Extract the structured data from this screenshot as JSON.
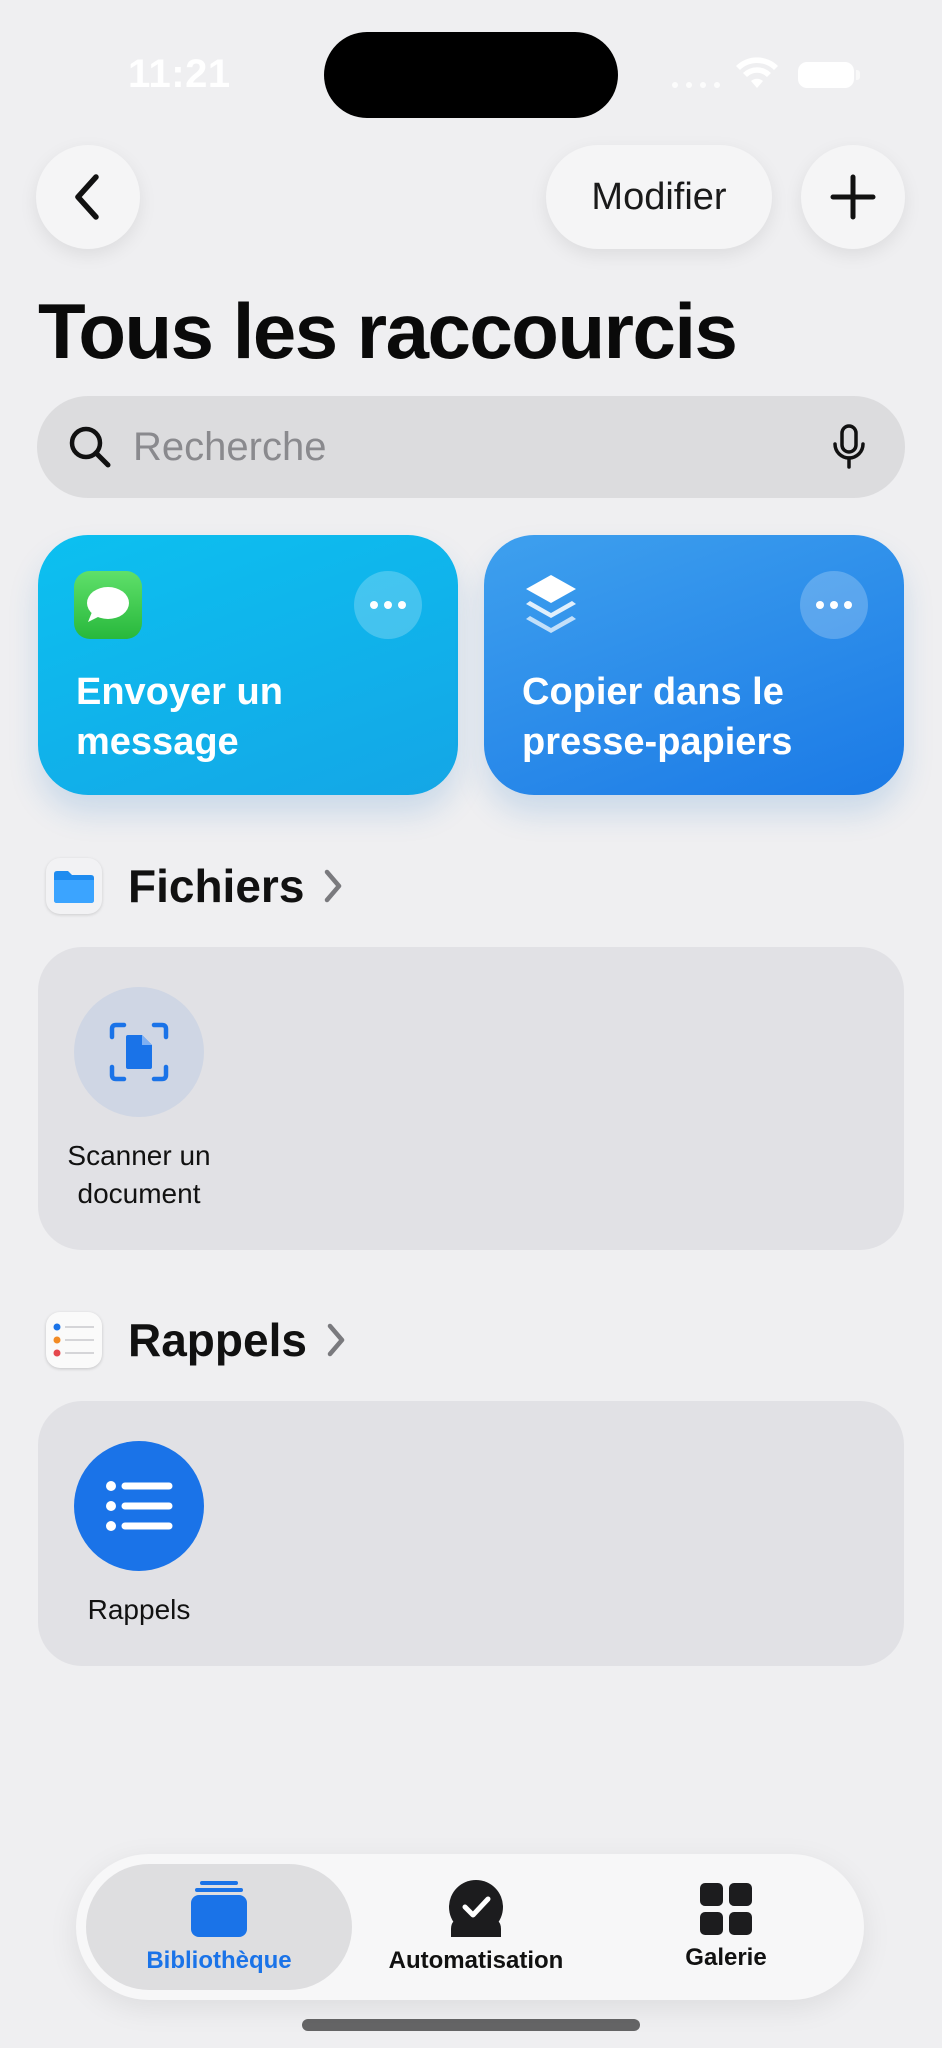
{
  "status_bar": {
    "time": "11:21"
  },
  "nav": {
    "edit_label": "Modifier"
  },
  "page_title": "Tous les raccourcis",
  "search": {
    "placeholder": "Recherche"
  },
  "shortcuts": [
    {
      "title": "Envoyer un message",
      "icon": "messages-icon",
      "color": "#14b2ec"
    },
    {
      "title": "Copier dans le presse-papiers",
      "icon": "layers-icon",
      "color": "#2a86e8"
    }
  ],
  "sections": [
    {
      "title": "Fichiers",
      "icon": "files-folder-icon",
      "items": [
        {
          "label": "Scanner un document",
          "icon": "scan-document-icon"
        }
      ]
    },
    {
      "title": "Rappels",
      "icon": "reminders-app-icon",
      "items": [
        {
          "label": "Rappels",
          "icon": "list-icon"
        }
      ]
    }
  ],
  "tabs": [
    {
      "label": "Bibliothèque",
      "icon": "library-stack-icon",
      "active": true
    },
    {
      "label": "Automatisation",
      "icon": "automation-check-icon",
      "active": false
    },
    {
      "label": "Galerie",
      "icon": "gallery-grid-icon",
      "active": false
    }
  ],
  "colors": {
    "accent": "#1a73e8",
    "background": "#efeff1",
    "tile_bg": "#e1e1e5"
  }
}
